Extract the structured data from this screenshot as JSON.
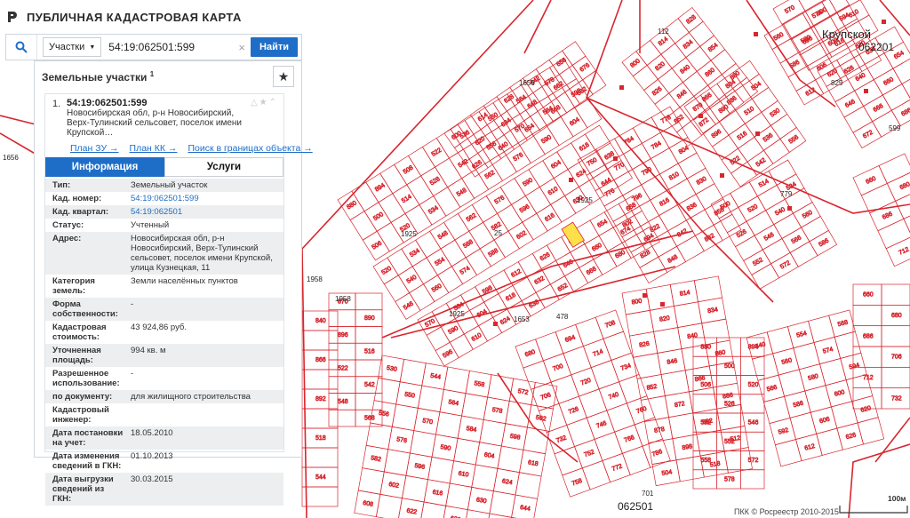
{
  "header": {
    "title": "ПУБЛИЧНАЯ КАДАСТРОВАЯ КАРТА"
  },
  "search": {
    "scope": "Участки",
    "value": "54:19:062501:599",
    "button": "Найти"
  },
  "panel": {
    "title": "Земельные участки",
    "count": "1",
    "result": {
      "index": "1.",
      "number": "54:19:062501:599",
      "address_short": "Новосибирская обл, р-н Новосибирский, Верх-Тулинский сельсовет, поселок имени Крупской…",
      "links": [
        "План ЗУ →",
        "План КК →",
        "Поиск в границах объекта →"
      ]
    },
    "tabs": [
      "Информация",
      "Услуги"
    ],
    "info_rows": [
      {
        "k": "Тип:",
        "v": "Земельный участок"
      },
      {
        "k": "Кад. номер:",
        "v": "54:19:062501:599",
        "link": true
      },
      {
        "k": "Кад. квартал:",
        "v": "54:19:062501",
        "link": true
      },
      {
        "k": "Статус:",
        "v": "Учтенный"
      },
      {
        "k": "Адрес:",
        "v": "Новосибирская обл, р-н Новосибирский, Верх-Тулинский сельсовет, поселок имени Крупской, улица Кузнецкая, 11"
      },
      {
        "k": "Категория земель:",
        "v": "Земли населённых пунктов"
      },
      {
        "k": "Форма собственности:",
        "v": "-"
      },
      {
        "k": "Кадастровая стоимость:",
        "v": "43 924,86 руб."
      },
      {
        "k": "Уточненная площадь:",
        "v": "994 кв. м"
      },
      {
        "k": "Разрешенное использование:",
        "v": "-"
      },
      {
        "k": "по документу:",
        "v": "для жилищного строительства"
      },
      {
        "k": "Кадастровый инженер:",
        "v": ""
      },
      {
        "k": "Дата постановки на учет:",
        "v": "18.05.2010"
      },
      {
        "k": "Дата изменения сведений в ГКН:",
        "v": "01.10.2013"
      },
      {
        "k": "Дата выгрузки сведений из ГКН:",
        "v": "30.03.2015"
      }
    ]
  },
  "map": {
    "place_label": "Крупской",
    "quarter_labels": [
      "062201",
      "062501"
    ],
    "parcel_labels": [
      "1656",
      "1656",
      "1925",
      "1925",
      "1925",
      "1958",
      "1958",
      "1653",
      "701",
      "779",
      "478",
      "825",
      "599",
      "112",
      "25"
    ],
    "attribution": "ПКК © Росреестр 2010-2015",
    "scale_label": "100м",
    "colors": {
      "parcel": "#d8262e",
      "highlight": "#ffe04a",
      "accent": "#1e6ec8"
    }
  }
}
